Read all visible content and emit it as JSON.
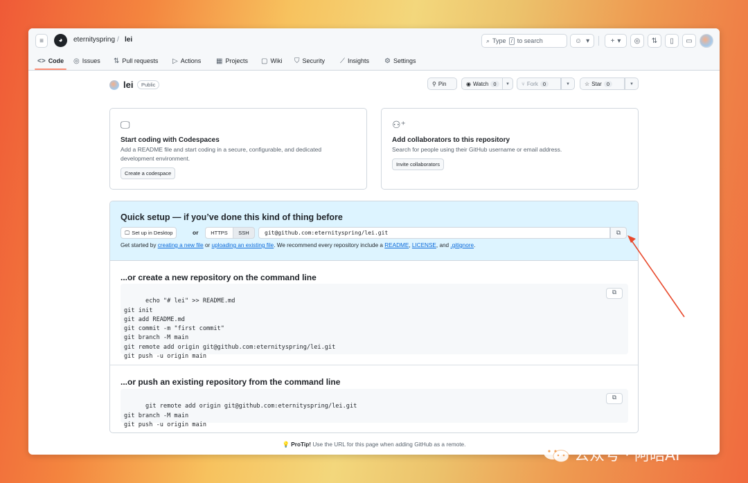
{
  "header": {
    "owner": "eternityspring",
    "separator": "/",
    "repo": "lei",
    "search_label_pre": "Type",
    "search_key": "/",
    "search_label_post": "to search",
    "plus": "+",
    "caret": "▾"
  },
  "tabs": [
    {
      "label": "Code",
      "icon": "code-icon",
      "glyph": "<>"
    },
    {
      "label": "Issues",
      "icon": "issue-icon",
      "glyph": "◎"
    },
    {
      "label": "Pull requests",
      "icon": "pull-request-icon",
      "glyph": "⇅"
    },
    {
      "label": "Actions",
      "icon": "play-icon",
      "glyph": "▷"
    },
    {
      "label": "Projects",
      "icon": "table-icon",
      "glyph": "▦"
    },
    {
      "label": "Wiki",
      "icon": "book-icon",
      "glyph": "▢"
    },
    {
      "label": "Security",
      "icon": "shield-icon",
      "glyph": "⛉"
    },
    {
      "label": "Insights",
      "icon": "graph-icon",
      "glyph": "⟋"
    },
    {
      "label": "Settings",
      "icon": "gear-icon",
      "glyph": "⚙"
    }
  ],
  "repo_header": {
    "name": "lei",
    "visibility": "Public",
    "pin": "Pin",
    "watch": "Watch",
    "watch_count": "0",
    "fork": "Fork",
    "fork_count": "0",
    "star": "Star",
    "star_count": "0"
  },
  "cards": {
    "codespaces": {
      "title": "Start coding with Codespaces",
      "desc": "Add a README file and start coding in a secure, configurable, and dedicated development environment.",
      "button": "Create a codespace"
    },
    "collaborators": {
      "title": "Add collaborators to this repository",
      "desc": "Search for people using their GitHub username or email address.",
      "button": "Invite collaborators"
    }
  },
  "quick_setup": {
    "title": "Quick setup — if you’ve done this kind of thing before",
    "desktop_button": "Set up in Desktop",
    "or": "or",
    "https": "HTTPS",
    "ssh": "SSH",
    "url": "git@github.com:eternityspring/lei.git",
    "help_1": "Get started by ",
    "link_new_file": "creating a new file",
    "help_2": " or ",
    "link_upload": "uploading an existing file",
    "help_3": ". We recommend every repository include a ",
    "link_readme": "README",
    "help_4": ", ",
    "link_license": "LICENSE",
    "help_5": ", and ",
    "link_gitignore": ".gitignore",
    "help_6": "."
  },
  "new_repo": {
    "title": "...or create a new repository on the command line",
    "code": "echo \"# lei\" >> README.md\ngit init\ngit add README.md\ngit commit -m \"first commit\"\ngit branch -M main\ngit remote add origin git@github.com:eternityspring/lei.git\ngit push -u origin main"
  },
  "push_existing": {
    "title": "...or push an existing repository from the command line",
    "code": "git remote add origin git@github.com:eternityspring/lei.git\ngit branch -M main\ngit push -u origin main"
  },
  "protip": {
    "label": "ProTip!",
    "text": " Use the URL for this page when adding GitHub as a remote."
  },
  "watermark": {
    "text": "公众号 · 阿皓AI"
  },
  "colors": {
    "active_tab_underline": "#fd8c73",
    "link": "#0969da",
    "quick_setup_bg": "#ddf4ff",
    "annotation_arrow": "#e8492c"
  }
}
